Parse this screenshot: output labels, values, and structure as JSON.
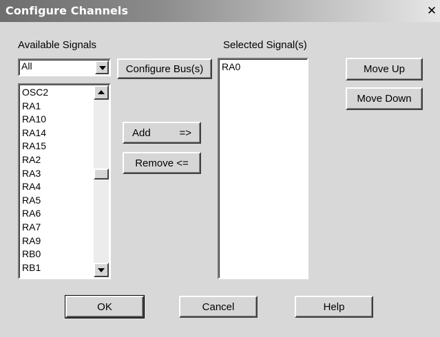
{
  "window": {
    "title": "Configure Channels",
    "close_glyph": "✕"
  },
  "available": {
    "label": "Available Signals",
    "filter_value": "All",
    "items": [
      "OSC2",
      "RA1",
      "RA10",
      "RA14",
      "RA15",
      "RA2",
      "RA3",
      "RA4",
      "RA5",
      "RA6",
      "RA7",
      "RA9",
      "RB0",
      "RB1"
    ],
    "scroll_position": 0.45
  },
  "buttons": {
    "configure_bus": "Configure Bus(s)",
    "add_label": "Add",
    "add_arrow": "=>",
    "remove": "Remove <=",
    "move_up": "Move Up",
    "move_down": "Move Down",
    "ok": "OK",
    "cancel": "Cancel",
    "help": "Help"
  },
  "selected": {
    "label": "Selected Signal(s)",
    "items": [
      "RA0"
    ]
  },
  "icons": {
    "close": "close-icon",
    "dropdown": "chevron-down-icon",
    "scroll_up": "scroll-up-icon",
    "scroll_down": "scroll-down-icon"
  }
}
